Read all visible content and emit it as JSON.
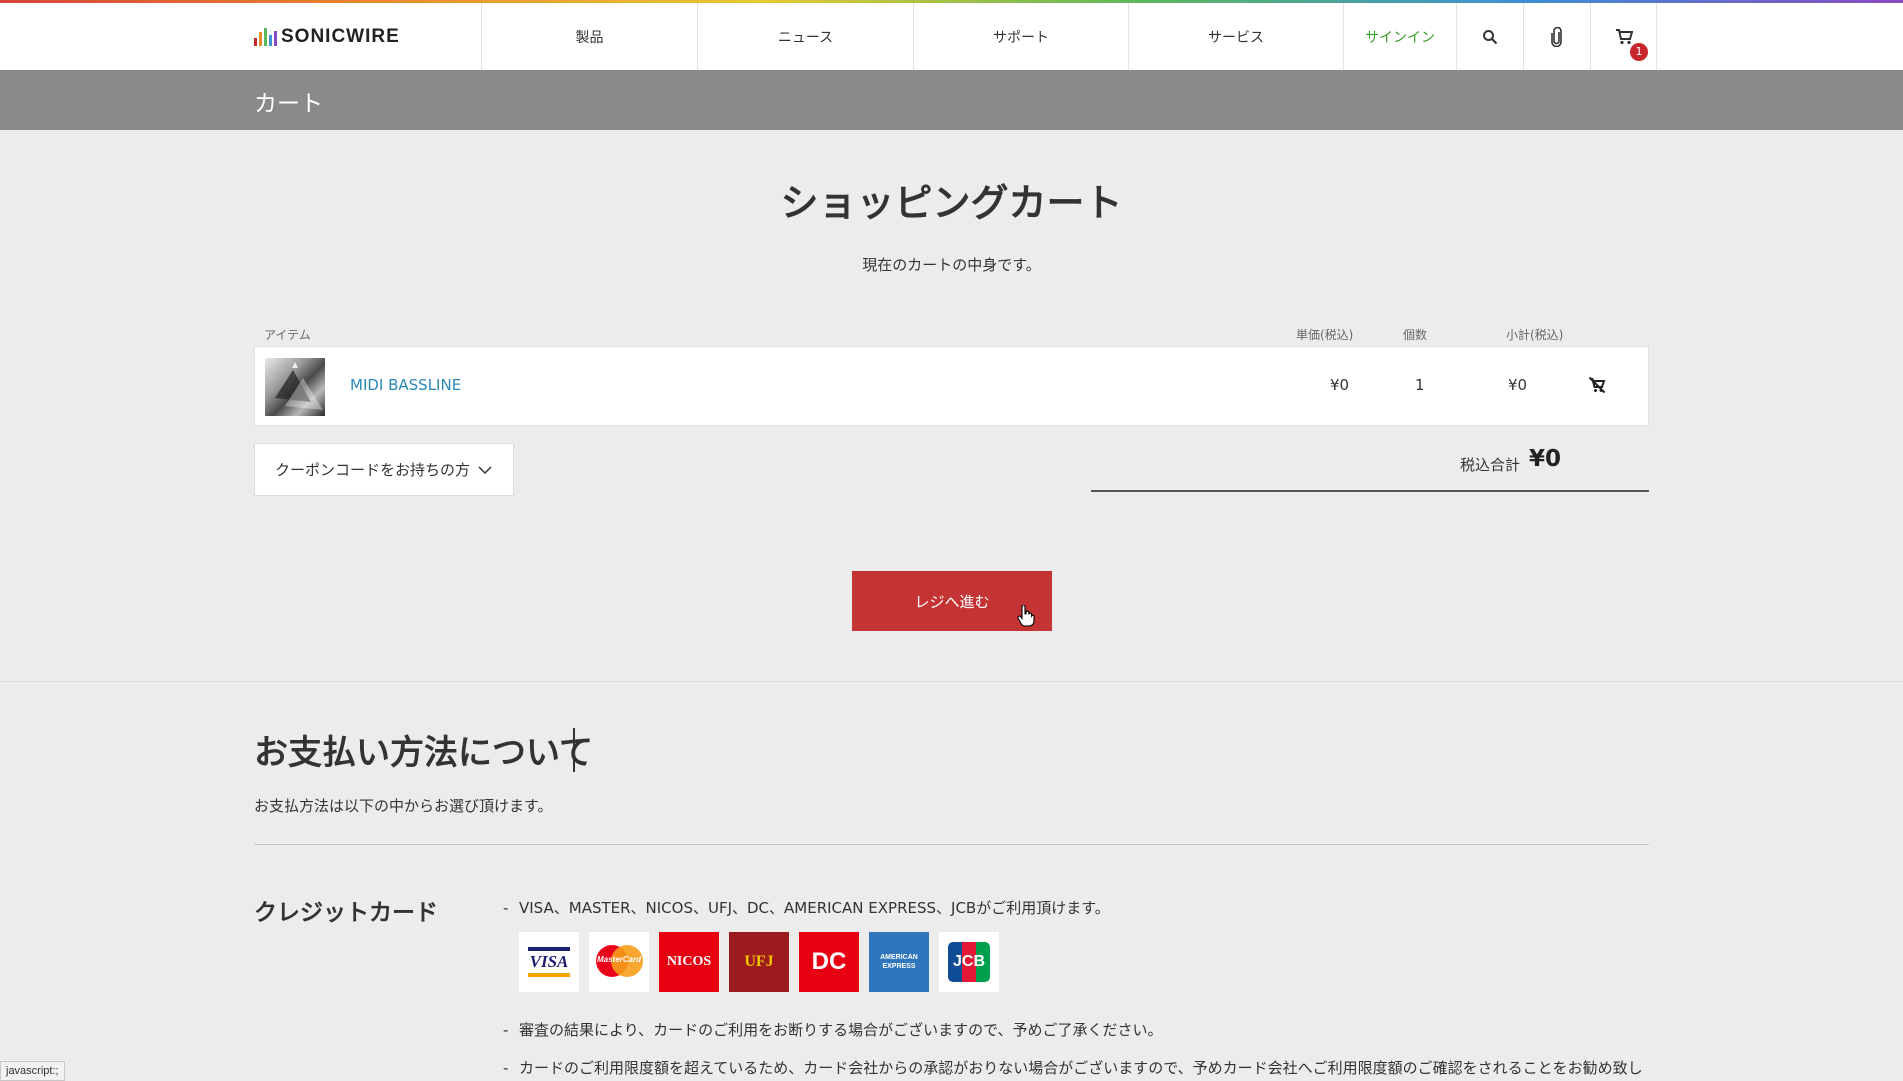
{
  "brand": {
    "name": "SONICWIRE"
  },
  "nav": {
    "products": "製品",
    "news": "ニュース",
    "support": "サポート",
    "services": "サービス",
    "signin": "サインイン",
    "cart_count": "1"
  },
  "page_title": "カート",
  "cart": {
    "heading": "ショッピングカート",
    "subtitle": "現在のカートの中身です。",
    "columns": {
      "item": "アイテム",
      "unit_price": "単価(税込)",
      "qty": "個数",
      "subtotal": "小計(税込)"
    },
    "items": [
      {
        "name": "MIDI BASSLINE",
        "unit_price": "¥0",
        "qty": "1",
        "subtotal": "¥0"
      }
    ],
    "coupon_label": "クーポンコードをお持ちの方",
    "total_label": "税込合計",
    "total_value": "¥0",
    "checkout_label": "レジへ進む"
  },
  "payment": {
    "heading": "お支払い方法について",
    "subtitle": "お支払方法は以下の中からお選び頂けます。",
    "credit_heading": "クレジットカード",
    "lines": [
      "VISA、MASTER、NICOS、UFJ、DC、AMERICAN EXPRESS、JCBがご利用頂けます。",
      "審査の結果により、カードのご利用をお断りする場合がございますので、予めご了承ください。",
      "カードのご利用限度額を超えているため、カード会社からの承認がおりない場合がございますので、予めカード会社へご利用限度額のご確認をされることをお勧め致し"
    ],
    "card_logos": [
      {
        "name": "VISA",
        "text": "VISA",
        "bg": "#ffffff",
        "fg": "#1a1f71"
      },
      {
        "name": "MasterCard",
        "text": "MasterCard",
        "bg": "#ffffff",
        "fg": "#ffffff"
      },
      {
        "name": "NICOS",
        "text": "NICOS",
        "bg": "#e60012",
        "fg": "#ffffff"
      },
      {
        "name": "UFJ Card",
        "text": "UFJ",
        "bg": "#9b1b1f",
        "fg": "#ffffff"
      },
      {
        "name": "DC",
        "text": "DC",
        "bg": "#e60012",
        "fg": "#ffffff"
      },
      {
        "name": "AMERICAN EXPRESS",
        "text": "AMERICAN EXPRESS",
        "bg": "#2e77bc",
        "fg": "#ffffff"
      },
      {
        "name": "JCB",
        "text": "JCB",
        "bg": "#ffffff",
        "fg": "#ffffff"
      }
    ]
  },
  "status_bar": "javascript:;",
  "colors": {
    "accent_red": "#c53434",
    "signin_green": "#3a9a2a",
    "link_blue": "#2a88b8",
    "title_bar": "#8a8a8a"
  }
}
